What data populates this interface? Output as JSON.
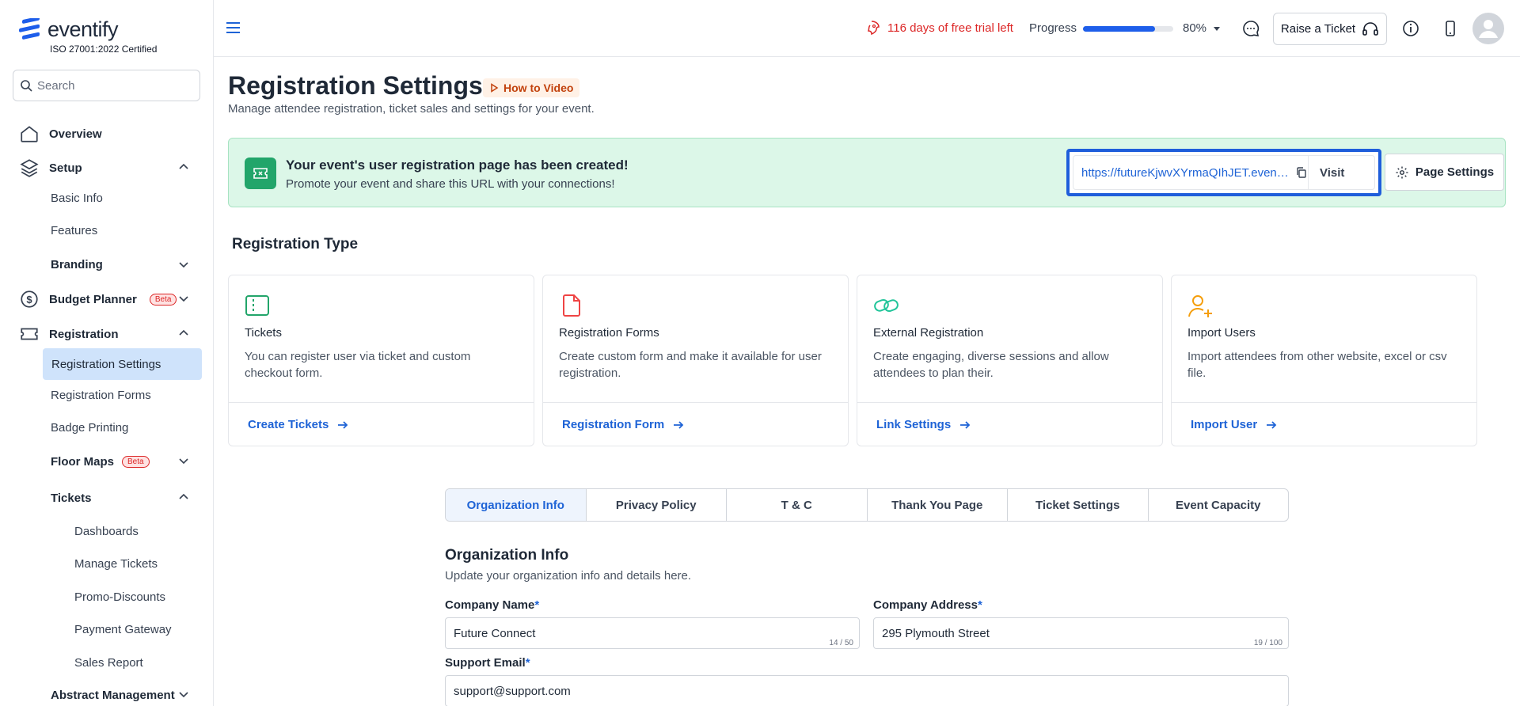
{
  "brand": {
    "name": "eventify",
    "certification": "ISO 27001:2022 Certified"
  },
  "search": {
    "placeholder": "Search"
  },
  "sidebar": {
    "overview": "Overview",
    "setup": "Setup",
    "basic_info": "Basic Info",
    "features": "Features",
    "branding": "Branding",
    "budget_planner": "Budget Planner",
    "beta": "Beta",
    "registration": "Registration",
    "registration_settings": "Registration Settings",
    "registration_forms": "Registration Forms",
    "badge_printing": "Badge Printing",
    "floor_maps": "Floor Maps",
    "tickets": "Tickets",
    "dashboards": "Dashboards",
    "manage_tickets": "Manage Tickets",
    "promo_discounts": "Promo-Discounts",
    "payment_gateway": "Payment Gateway",
    "sales_report": "Sales Report",
    "abstract_management": "Abstract Management"
  },
  "topbar": {
    "trial": "116 days of free trial left",
    "progress_label": "Progress",
    "progress_value": 0.8,
    "progress_text": "80%",
    "raise_ticket": "Raise a Ticket"
  },
  "page": {
    "title": "Registration Settings",
    "how_to": "How to Video",
    "subtitle": "Manage attendee registration, ticket sales and settings for your event."
  },
  "banner": {
    "title": "Your event's user registration page has been created!",
    "subtitle": "Promote your event and share this URL with your connections!",
    "url": "https://futureKjwvXYrmaQIhJET.eventify.io",
    "visit": "Visit",
    "page_settings": "Page Settings"
  },
  "registration_type": {
    "title": "Registration Type",
    "cards": [
      {
        "title": "Tickets",
        "desc": "You can register user via ticket and custom checkout form.",
        "link": "Create Tickets"
      },
      {
        "title": "Registration Forms",
        "desc": "Create custom form and make it available for user registration.",
        "link": "Registration Form"
      },
      {
        "title": "External Registration",
        "desc": "Create engaging, diverse sessions and allow attendees to plan their.",
        "link": "Link Settings"
      },
      {
        "title": "Import Users",
        "desc": "Import attendees from other website, excel or csv file.",
        "link": "Import User"
      }
    ]
  },
  "tabs": [
    "Organization Info",
    "Privacy Policy",
    "T & C",
    "Thank You Page",
    "Ticket Settings",
    "Event Capacity"
  ],
  "org": {
    "title": "Organization Info",
    "subtitle": "Update your organization info and details here.",
    "company_name_label": "Company Name",
    "company_name_value": "Future Connect",
    "company_name_count": "14 / 50",
    "company_address_label": "Company Address",
    "company_address_value": "295 Plymouth Street",
    "company_address_count": "19 / 100",
    "support_email_label": "Support Email",
    "support_email_value": "support@support.com",
    "required_mark": "*"
  },
  "colors": {
    "accent": "#1e63d6",
    "success": "#22a56a",
    "danger": "#dc2626",
    "active_nav": "#cfe3fb"
  }
}
